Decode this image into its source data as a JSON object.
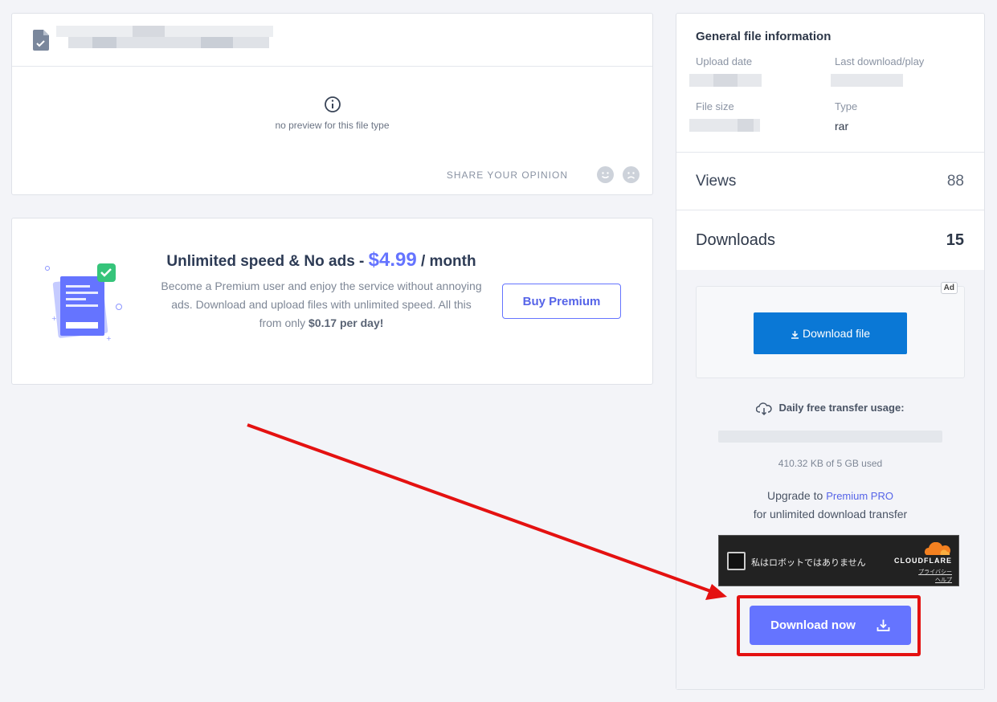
{
  "file_card": {
    "preview_message": "no preview for this file type",
    "share_opinion": "SHARE YOUR OPINION"
  },
  "premium": {
    "title_prefix": "Unlimited speed & No ads - ",
    "price": "$4.99",
    "title_suffix": " / month",
    "description_main": "Become a Premium user and enjoy the service without annoying ads. Download and upload files with unlimited speed. All this from only ",
    "description_bold": "$0.17 per day!",
    "buy_label": "Buy Premium"
  },
  "sidebar": {
    "info_title": "General file information",
    "upload_date_label": "Upload date",
    "last_download_label": "Last download/play",
    "file_size_label": "File size",
    "type_label": "Type",
    "type_value": "rar",
    "views_label": "Views",
    "views_value": "88",
    "downloads_label": "Downloads",
    "downloads_value": "15",
    "ad_badge": "Ad",
    "ad_download_label": "Download file",
    "transfer_title": "Daily free transfer usage:",
    "transfer_fraction": 8e-05,
    "transfer_used": "410.32 KB of 5 GB used",
    "upgrade_prefix": "Upgrade to",
    "upgrade_link": "Premium PRO",
    "upgrade_suffix": "for unlimited download transfer",
    "captcha_text": "私はロボットではありません",
    "captcha_brand": "CLOUDFLARE",
    "captcha_privacy": "プライバシー",
    "captcha_help": "ヘルプ",
    "download_now_label": "Download now"
  },
  "colors": {
    "accent": "#6574ff",
    "ad_button": "#0a78d6",
    "highlight": "#e41111"
  }
}
